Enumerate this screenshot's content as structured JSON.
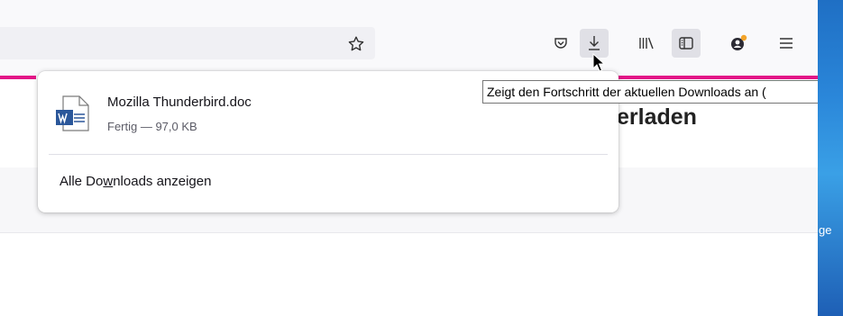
{
  "toolbar": {
    "icons": [
      "bookmark-star-icon",
      "pocket-icon",
      "downloads-icon",
      "library-icon",
      "sidebar-icon",
      "account-icon",
      "menu-icon"
    ]
  },
  "page": {
    "heading_fragment": "erladen"
  },
  "downloads_panel": {
    "file_name": "Mozilla Thunderbird.doc",
    "file_status": "Fertig — 97,0 KB",
    "show_all_pre": "Alle Do",
    "show_all_underlined": "w",
    "show_all_post": "nloads anzeigen"
  },
  "tooltip": {
    "text": "Zeigt den Fortschritt der aktuellen Downloads an ("
  },
  "desktop_strip": {
    "partial_text": "ge"
  },
  "colors": {
    "accent": "#e31587",
    "word_blue": "#2b579a"
  }
}
